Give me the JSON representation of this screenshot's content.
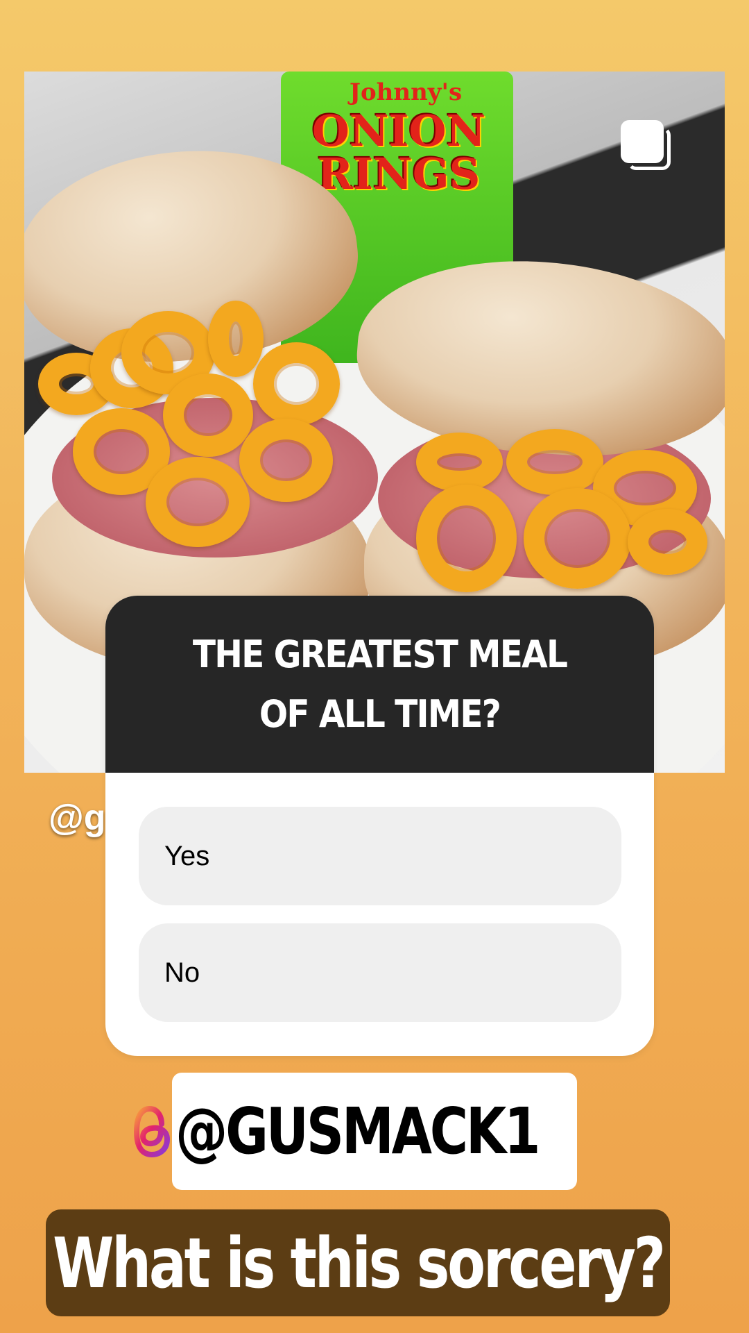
{
  "photo": {
    "bag_top_text": "Johnny's",
    "bag_title": "ONION RINGS",
    "handle_peek": "@gu"
  },
  "poll": {
    "question": "THE GREATEST MEAL OF ALL TIME?",
    "options": [
      "Yes",
      "No"
    ]
  },
  "mention": {
    "handle": "@GUSMACK1",
    "icon": "threads-icon"
  },
  "caption": {
    "text": "What is this sorcery?"
  },
  "colors": {
    "background_top": "#f4c96a",
    "background_bottom": "#eea24a",
    "poll_header": "#262626",
    "caption_bg": "#5c3d14"
  }
}
